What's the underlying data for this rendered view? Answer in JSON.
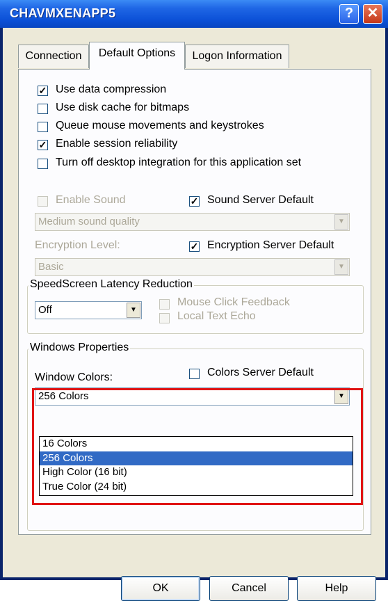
{
  "window": {
    "title": "CHAVMXENAPP5",
    "help_symbol": "?",
    "close_symbol": "✕"
  },
  "tabs": [
    "Connection",
    "Default Options",
    "Logon Information"
  ],
  "options": [
    {
      "label": "Use data compression",
      "checked": true
    },
    {
      "label": "Use disk cache for bitmaps",
      "checked": false
    },
    {
      "label": "Queue mouse movements and keystrokes",
      "checked": false
    },
    {
      "label": "Enable session reliability",
      "checked": true
    },
    {
      "label": "Turn off desktop integration for this application set",
      "checked": false
    }
  ],
  "sound": {
    "enable_label": "Enable Sound",
    "server_default_label": "Sound Server Default",
    "quality_value": "Medium sound quality"
  },
  "encryption": {
    "level_label": "Encryption Level:",
    "server_default_label": "Encryption Server Default",
    "value": "Basic"
  },
  "speedscreen": {
    "title": "SpeedScreen Latency Reduction",
    "value": "Off",
    "mouse_click_label": "Mouse Click Feedback",
    "local_echo_label": "Local Text Echo"
  },
  "windows_properties": {
    "title": "Windows Properties",
    "colors_label": "Window Colors:",
    "colors_server_default_label": "Colors Server Default",
    "colors_value": "256 Colors",
    "color_options": [
      "16 Colors",
      "256 Colors",
      "High Color (16 bit)",
      "True Color (24 bit)"
    ],
    "selected_index": 1
  },
  "buttons": {
    "ok": "OK",
    "cancel": "Cancel",
    "help": "Help"
  },
  "check_mark": "✓",
  "dropdown_arrow": "▼"
}
